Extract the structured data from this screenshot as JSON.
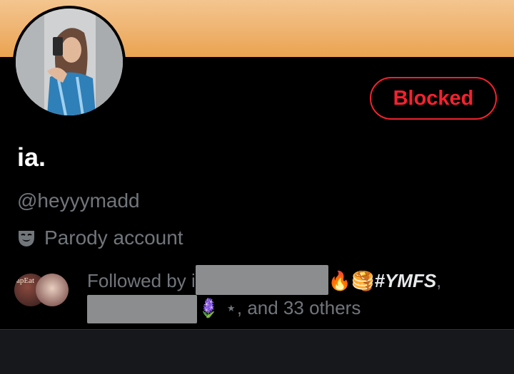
{
  "profile": {
    "display_name": "ia.",
    "handle": "@heyyymadd",
    "account_label": "Parody account",
    "blocked_button": "Blocked"
  },
  "followers": {
    "prefix": "Followed by i",
    "emoji_after_first": "🔥🥞",
    "hashtag": "#YMFS",
    "comma": ",",
    "emoji_after_second": "🪻",
    "tail": " ⋆, and 33 others",
    "avatar_text": "apEat"
  },
  "colors": {
    "blocked_red": "#f4212e",
    "muted_text": "#71767b",
    "banner": "#efb36f"
  },
  "icons": {
    "label_icon": "theater-mask-icon"
  }
}
